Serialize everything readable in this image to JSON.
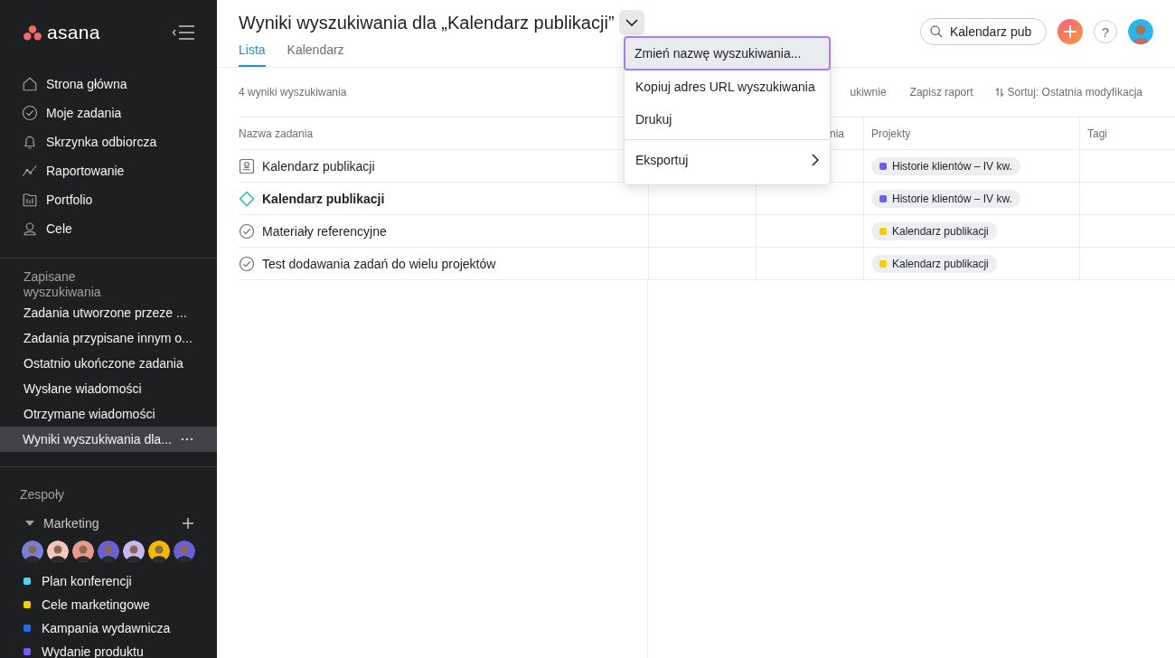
{
  "sidebar": {
    "logo": "asana",
    "nav": [
      {
        "kind": "home",
        "label": "Strona główna"
      },
      {
        "kind": "check",
        "label": "Moje zadania"
      },
      {
        "kind": "bell",
        "label": "Skrzynka odbiorcza"
      },
      {
        "kind": "chart",
        "label": "Raportowanie"
      },
      {
        "kind": "folder",
        "label": "Portfolio"
      },
      {
        "kind": "person",
        "label": "Cele"
      }
    ],
    "saved_title": "Zapisane wyszukiwania",
    "saved": [
      {
        "label": "Zadania utworzone przeze ...",
        "selected": false
      },
      {
        "label": "Zadania przypisane innym o...",
        "selected": false
      },
      {
        "label": "Ostatnio ukończone zadania",
        "selected": false
      },
      {
        "label": "Wysłane wiadomości",
        "selected": false
      },
      {
        "label": "Otrzymane wiadomości",
        "selected": false
      },
      {
        "label": "Wyniki wyszukiwania dla...",
        "selected": true
      }
    ],
    "teams_title": "Zespoły",
    "team": {
      "name": "Marketing",
      "expanded": true,
      "avatars": [
        {
          "color": "#7b7fd8"
        },
        {
          "color": "#f0c8c0"
        },
        {
          "color": "#e89a90"
        },
        {
          "color": "#6a5fd8"
        },
        {
          "color": "#c9b8f0"
        },
        {
          "color": "#f5b800"
        },
        {
          "color": "#6a5fd8"
        }
      ],
      "projects": [
        {
          "name": "Plan konferencji",
          "color": "#4ad6f5"
        },
        {
          "name": "Cele marketingowe",
          "color": "#f5cf00"
        },
        {
          "name": "Kampania wydawnicza",
          "color": "#1a6cf5"
        },
        {
          "name": "Wydanie produktu",
          "color": "#7a5cf5"
        }
      ]
    }
  },
  "header": {
    "title": "Wyniki wyszukiwania dla „Kalendarz publikacji”",
    "tabs": [
      {
        "label": "Lista",
        "selected": true
      },
      {
        "label": "Kalendarz",
        "selected": false
      }
    ],
    "search": {
      "value": "Kalendarz pub"
    },
    "help": "?"
  },
  "toolbar": {
    "count": "4 wyniki wyszukiwania",
    "partial_action": "ukiwnie",
    "save_report": "Zapisz raport",
    "sort": "Sortuj: Ostatnia modyfikacja"
  },
  "table": {
    "columns": [
      "Nazwa zadania",
      "",
      "nia",
      "Projekty",
      "Tagi"
    ],
    "rows": [
      {
        "kind": "approval",
        "name": "Kalendarz publikacji",
        "project": {
          "name": "Historie klientów – IV kw.",
          "color": "#6c5cf0"
        }
      },
      {
        "kind": "milestone",
        "name": "Kalendarz publikacji",
        "project": {
          "name": "Historie klientów – IV kw.",
          "color": "#6c5cf0"
        }
      },
      {
        "kind": "task",
        "name": "Materiały referencyjne",
        "project": {
          "name": "Kalendarz publikacji",
          "color": "#f5cf00"
        }
      },
      {
        "kind": "task",
        "name": "Test dodawania zadań do wielu projektów",
        "project": {
          "name": "Kalendarz publikacji",
          "color": "#f5cf00"
        }
      }
    ]
  },
  "menu": {
    "items": [
      {
        "label": "Zmień nazwę wyszukiwania...",
        "selected": true,
        "submenu": false
      },
      {
        "label": "Kopiuj adres URL wyszukiwania",
        "selected": false,
        "submenu": false
      },
      {
        "label": "Drukuj",
        "selected": false,
        "submenu": false
      },
      {
        "label": "Eksportuj",
        "selected": false,
        "submenu": true
      }
    ]
  }
}
